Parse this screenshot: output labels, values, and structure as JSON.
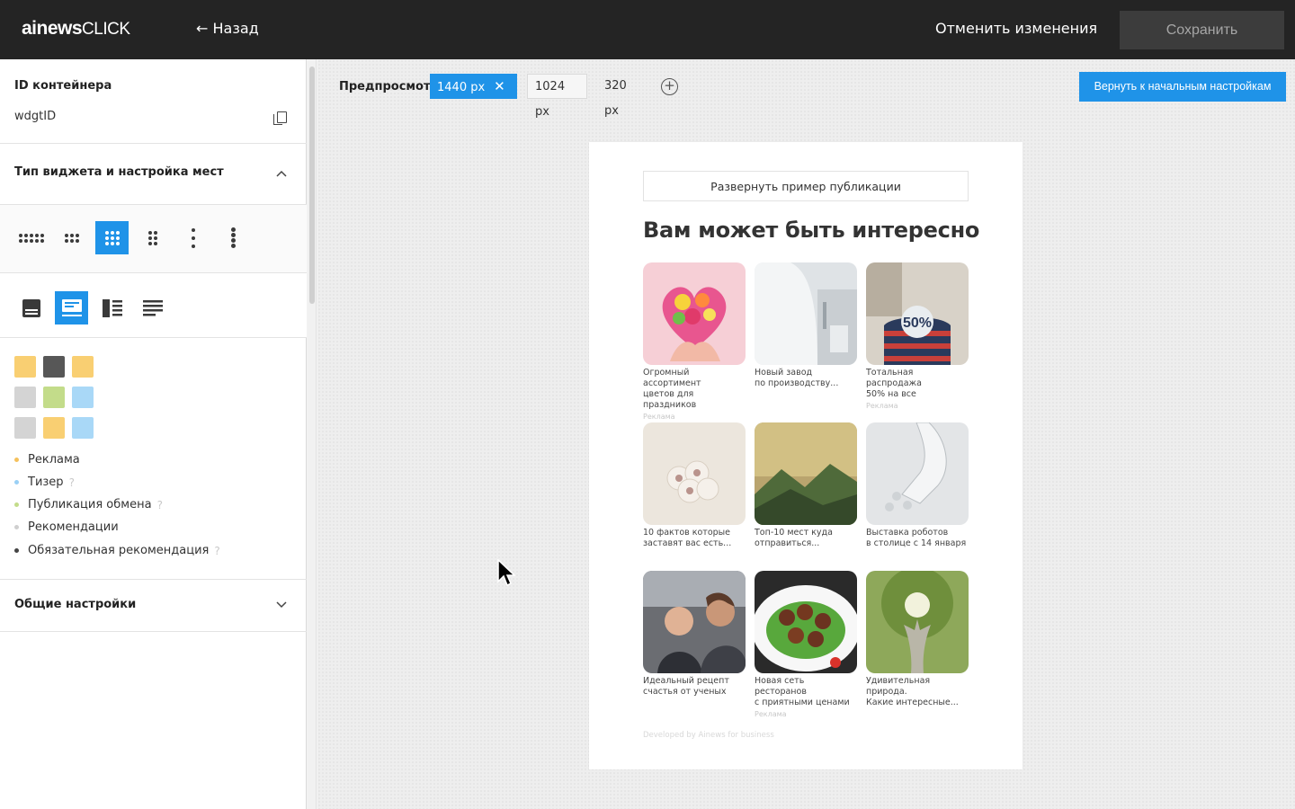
{
  "app": {
    "logo_bold": "ainews",
    "logo_light": "CLICK",
    "back_label": "← Назад",
    "cancel_label": "Отменить изменения",
    "save_label": "Сохранить"
  },
  "sidebar": {
    "container_id_title": "ID контейнера",
    "container_id_value": "wdgtID",
    "widget_type_title": "Тип виджета и настройка мест",
    "general_settings_title": "Общие настройки",
    "legend": [
      {
        "label": "Реклама",
        "color": "#f5c15c",
        "help": ""
      },
      {
        "label": "Тизер",
        "color": "#9ad0f5",
        "help": "?"
      },
      {
        "label": "Публикация обмена",
        "color": "#c3dc8a",
        "help": "?"
      },
      {
        "label": "Рекомендации",
        "color": "#cfcfcf",
        "help": ""
      },
      {
        "label": "Обязательная рекомендация",
        "color": "#444444",
        "help": "?"
      }
    ],
    "swatch_colors": [
      [
        "#f9cf72",
        "#575757",
        "#f9cf72"
      ],
      [
        "#d4d4d4",
        "#c3dc8a",
        "#a9d8f7"
      ],
      [
        "#d4d4d4",
        "#f9cf72",
        "#a9d8f7"
      ]
    ]
  },
  "preview": {
    "label": "Предпросмотр",
    "options": [
      "1440 px",
      "1024 px",
      "320 px"
    ],
    "close_glyph": "✕",
    "add_glyph": "+",
    "reset_label": "Вернуть к начальным настройкам",
    "expand_label": "Развернуть пример публикации",
    "widget_title": "Вам может быть интересно",
    "footer_note": "Developed by Ainews for business",
    "tiles": [
      {
        "title1": "Огромный ассортимент",
        "title2": "цветов для праздников",
        "ad": "Реклама",
        "icon": "flowers-heart-image"
      },
      {
        "title1": "Новый завод",
        "title2": "по производству...",
        "ad": "",
        "icon": "white-building-image"
      },
      {
        "title1": "Тотальная распродажа",
        "title2": "50% на все",
        "ad": "Реклама",
        "icon": "sale-shirt-image"
      },
      {
        "title1": "10 фактов которые",
        "title2": "заставят вас есть...",
        "ad": "",
        "icon": "garlic-image"
      },
      {
        "title1": "Топ-10 мест куда",
        "title2": "отправиться...",
        "ad": "",
        "icon": "mountain-landscape-image"
      },
      {
        "title1": "Выставка роботов",
        "title2": "в столице с 14 января",
        "ad": "",
        "icon": "robot-hand-image"
      },
      {
        "title1": "Идеальный рецепт",
        "title2": "счастья от ученых",
        "ad": "",
        "icon": "laughing-people-image"
      },
      {
        "title1": "Новая сеть ресторанов",
        "title2": "с приятными ценами",
        "ad": "Реклама",
        "icon": "meatballs-image"
      },
      {
        "title1": "Удивительная природа.",
        "title2": "Какие интересные...",
        "ad": "",
        "icon": "big-tree-image"
      }
    ]
  }
}
